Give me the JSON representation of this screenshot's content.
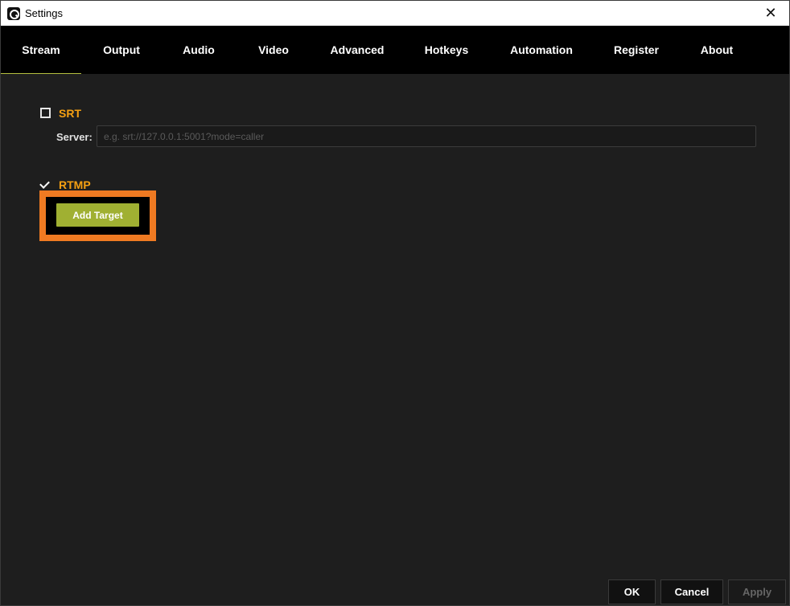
{
  "window": {
    "title": "Settings",
    "close_glyph": "✕",
    "app_icon": "app-logo-icon"
  },
  "tabs": [
    {
      "label": "Stream",
      "active": true
    },
    {
      "label": "Output"
    },
    {
      "label": "Audio"
    },
    {
      "label": "Video"
    },
    {
      "label": "Advanced"
    },
    {
      "label": "Hotkeys"
    },
    {
      "label": "Automation"
    },
    {
      "label": "Register"
    },
    {
      "label": "About"
    }
  ],
  "stream": {
    "srt": {
      "label": "SRT",
      "checked": false,
      "server_label": "Server:",
      "server_value": "",
      "server_placeholder": "e.g. srt://127.0.0.1:5001?mode=caller"
    },
    "rtmp": {
      "label": "RTMP",
      "checked": true,
      "add_target_label": "Add Target"
    }
  },
  "footer": {
    "ok_label": "OK",
    "cancel_label": "Cancel",
    "apply_label": "Apply"
  },
  "colors": {
    "accent_label": "#f5a012",
    "button_green": "#a0b032",
    "highlight": "#ef7a22"
  }
}
